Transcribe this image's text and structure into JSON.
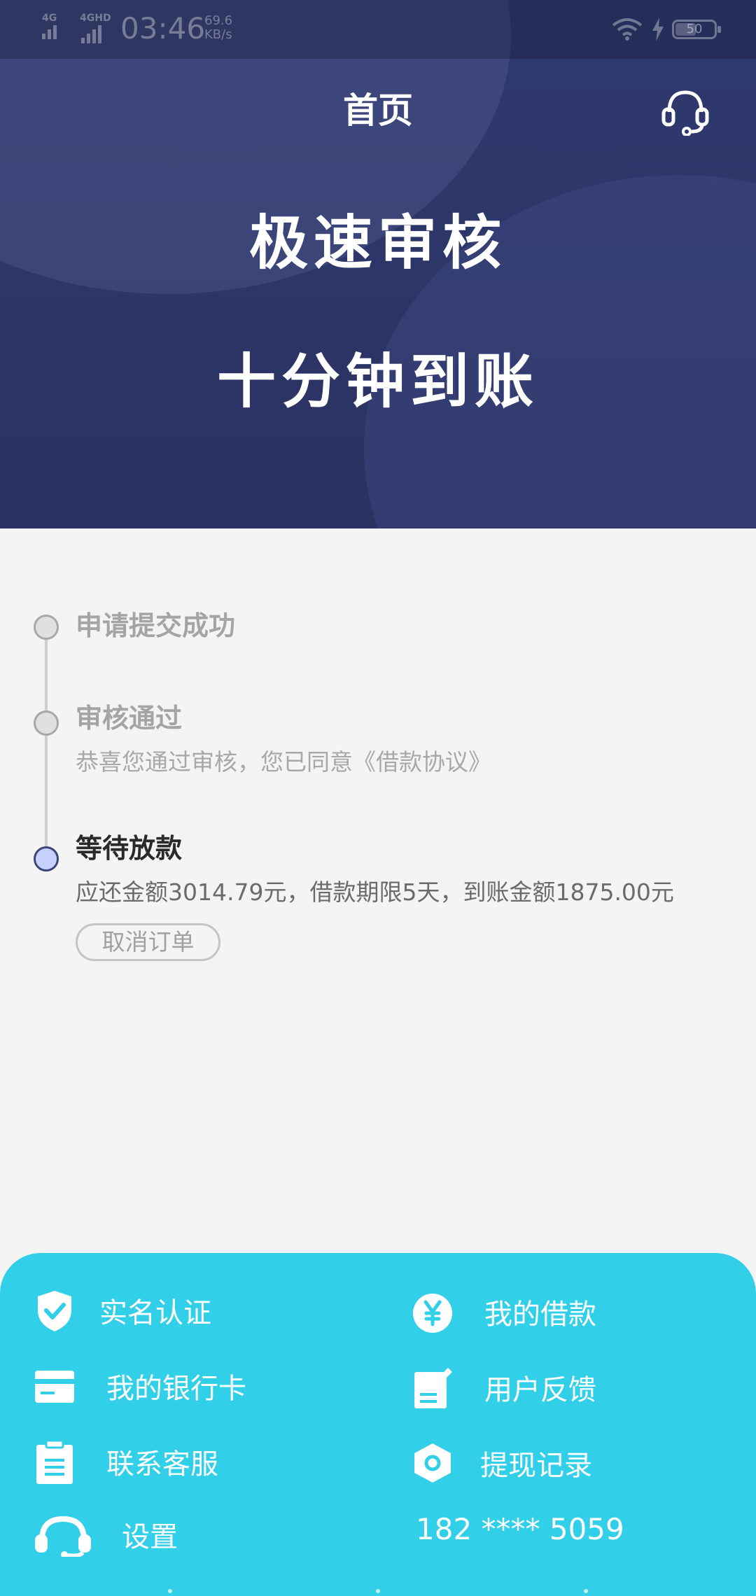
{
  "status_bar": {
    "signal1": "4G",
    "signal2": "4GHD",
    "time": "03:46",
    "speed_value": "69.6",
    "speed_unit": "KB/s",
    "battery": "50"
  },
  "header": {
    "title": "首页",
    "service_icon": "headset-icon"
  },
  "banner": {
    "line1": "极速审核",
    "line2": "十分钟到账"
  },
  "timeline": {
    "steps": [
      {
        "title": "申请提交成功",
        "desc": ""
      },
      {
        "title": "审核通过",
        "desc": "恭喜您通过审核，您已同意《借款协议》"
      },
      {
        "title": "等待放款",
        "desc": "应还金额3014.79元，借款期限5天，到账金额1875.00元"
      }
    ],
    "cancel_label": "取消订单"
  },
  "menu": {
    "items": [
      {
        "label": "实名认证",
        "icon": "shield-check-icon"
      },
      {
        "label": "我的借款",
        "icon": "yen-circle-icon"
      },
      {
        "label": "我的银行卡",
        "icon": "bank-card-icon"
      },
      {
        "label": "用户反馈",
        "icon": "feedback-icon"
      },
      {
        "label": "联系客服",
        "icon": "clipboard-icon"
      },
      {
        "label": "提现记录",
        "icon": "hexagon-icon"
      },
      {
        "label": "设置",
        "icon": "headset-icon"
      }
    ],
    "phone": "182 **** 5059"
  },
  "colors": {
    "banner": "#2c3566",
    "menu_bg": "#31cfe8",
    "page_bg": "#f4f4f4",
    "active_dot": "#c6d2fb"
  }
}
